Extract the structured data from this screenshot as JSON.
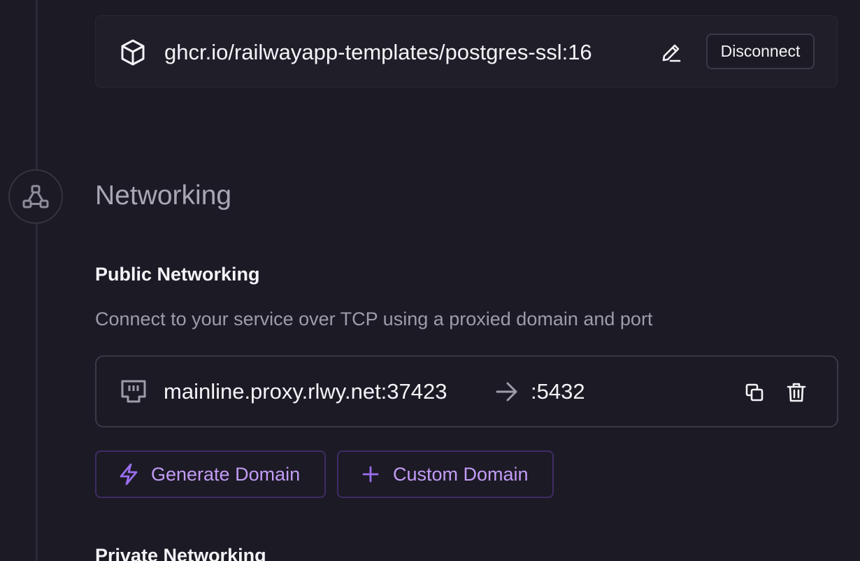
{
  "source": {
    "icon": "cube-icon",
    "image_name": "ghcr.io/railwayapp-templates/postgres-ssl:16",
    "edit_icon": "pencil-icon",
    "disconnect_label": "Disconnect"
  },
  "networking": {
    "section_icon": "network-icon",
    "title": "Networking",
    "public": {
      "title": "Public Networking",
      "description": "Connect to your service over TCP using a proxied domain and port",
      "endpoint": {
        "icon": "ethernet-port-icon",
        "domain": "mainline.proxy.rlwy.net:37423",
        "arrow_icon": "arrow-right-icon",
        "port": ":5432",
        "copy_icon": "copy-icon",
        "delete_icon": "trash-icon"
      },
      "generate_domain_label": "Generate Domain",
      "generate_domain_icon": "lightning-icon",
      "custom_domain_label": "Custom Domain",
      "custom_domain_icon": "plus-icon"
    },
    "private": {
      "title": "Private Networking"
    }
  },
  "colors": {
    "background": "#1c1a24",
    "card": "#201e29",
    "border": "#3b3945",
    "accent": "#c29cf7",
    "accent_border": "#3f2c66",
    "muted_text": "#9e9ca9"
  }
}
